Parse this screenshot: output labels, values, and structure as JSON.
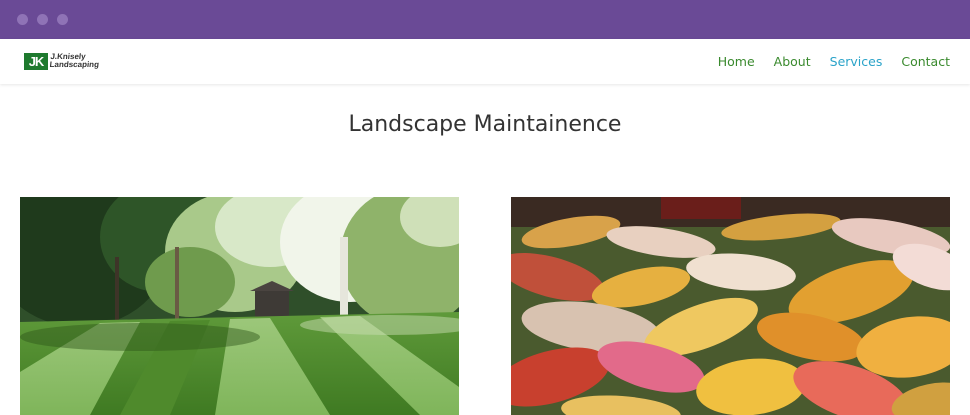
{
  "window": {
    "controls": [
      "close",
      "minimize",
      "zoom"
    ]
  },
  "site": {
    "logo_mark": "JK",
    "logo_line1": "J.Knisely",
    "logo_line2": "Landscaping"
  },
  "nav": {
    "items": [
      {
        "label": "Home",
        "active": false
      },
      {
        "label": "About",
        "active": false
      },
      {
        "label": "Services",
        "active": true
      },
      {
        "label": "Contact",
        "active": false
      }
    ]
  },
  "main": {
    "title": "Landscape Maintainence",
    "images": [
      {
        "subject": "striped mowed lawn with trees"
      },
      {
        "subject": "autumn leaves on grass"
      }
    ]
  },
  "colors": {
    "titlebar": "#6a4a96",
    "nav_link": "#3a8a2e",
    "nav_active": "#2aa3c9",
    "logo_green": "#1e7a2e"
  }
}
